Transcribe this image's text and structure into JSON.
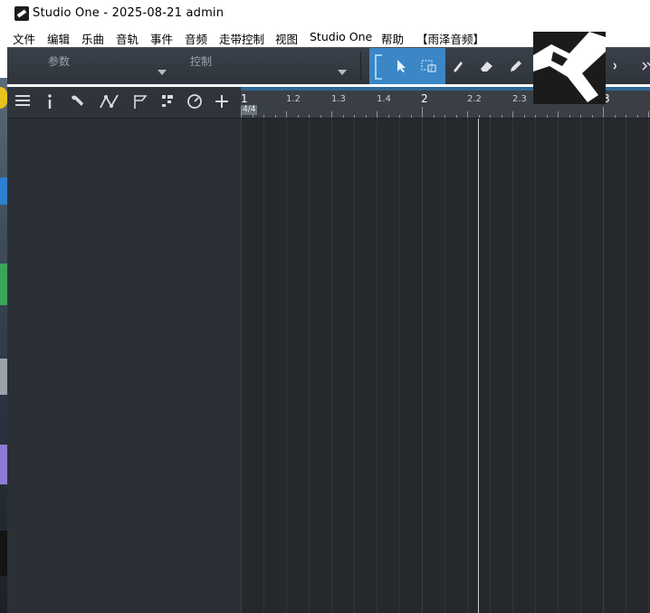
{
  "window": {
    "title": "Studio One - 2025-08-21 admin",
    "logo_icon": "studio-one-logo-icon"
  },
  "menu": {
    "items": [
      "文件",
      "编辑",
      "乐曲",
      "音轨",
      "事件",
      "音频",
      "走带控制",
      "视图",
      "Studio One",
      "帮助",
      "【雨泽音频】"
    ]
  },
  "toolbar": {
    "param_label": "参数",
    "control_label": "控制",
    "tools": [
      "arrow-tool-icon",
      "range-tool-icon",
      "paint-tool-icon",
      "eraser-tool-icon",
      "pencil-tool-icon",
      "speaker-icon",
      "more-icon"
    ]
  },
  "track_header": {
    "icons": [
      "track-list-icon",
      "inspector-info-icon",
      "wrench-icon",
      "automation-icon",
      "marker-flag-icon",
      "arranger-icon",
      "tempo-clock-icon",
      "add-track-icon"
    ]
  },
  "ruler": {
    "labels": [
      "1",
      "1.2",
      "1.3",
      "1.4",
      "2",
      "2.2",
      "2.3",
      "3"
    ],
    "time_signature": "4/4"
  },
  "colors": {
    "tool_active": "#3a86c7",
    "panel": "#2b3036",
    "arrange_bg": "#25282c"
  }
}
